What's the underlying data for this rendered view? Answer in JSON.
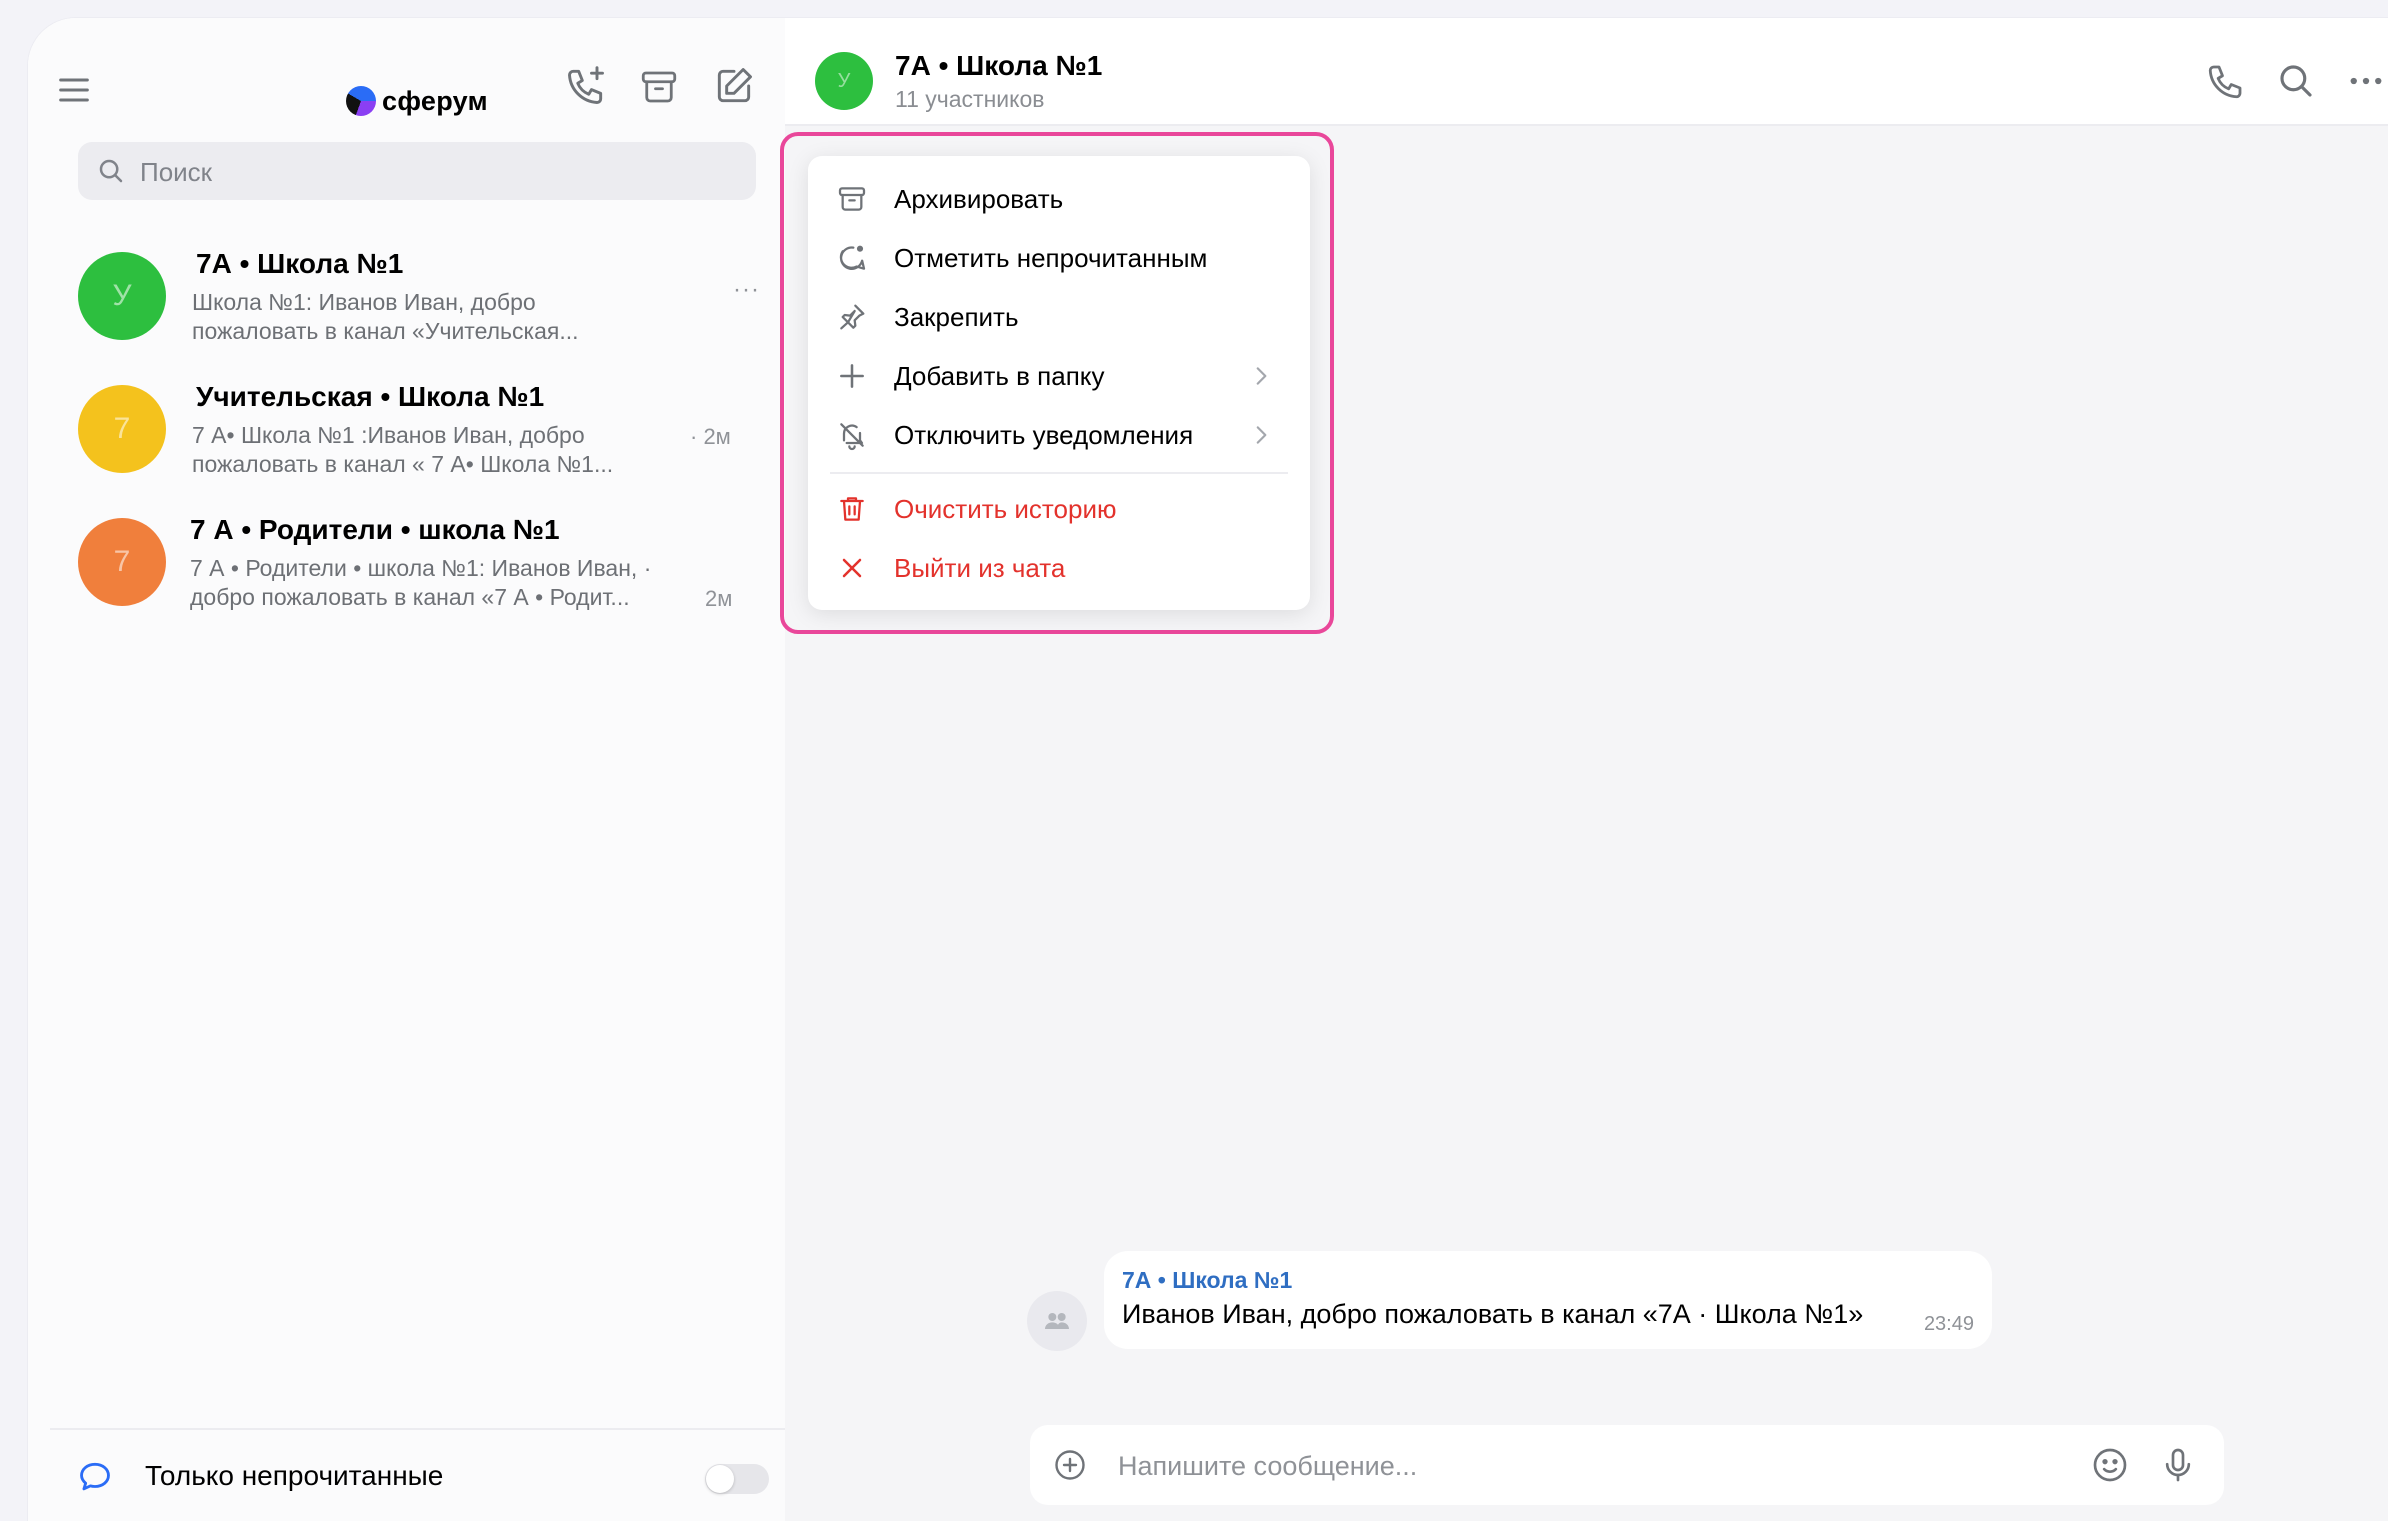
{
  "app": {
    "name": "сферум",
    "accent": "#2a6cf6",
    "danger_color": "#e3322c",
    "highlight_color": "#e9479a"
  },
  "sidebar": {
    "search": {
      "placeholder": "Поиск"
    },
    "header_icons": [
      "menu-icon",
      "call-add-icon",
      "archive-icon",
      "compose-icon"
    ],
    "chats": [
      {
        "title": "7А • Школа №1",
        "preview_line1": "Школа №1: Иванов Иван, добро",
        "preview_line2": "пожаловать в канал «Учительская...",
        "time": "",
        "more": "···",
        "avatar_letter": "У",
        "avatar_color": "#2dbf3f"
      },
      {
        "title": "Учительская • Школа №1",
        "preview_line1": "7 А• Школа №1 :Иванов Иван, добро",
        "preview_line2": "пожаловать в канал « 7 А• Школа №1...",
        "time": "· 2м",
        "avatar_letter": "7",
        "avatar_color": "#f4c21d"
      },
      {
        "title": "7 А • Родители • школа №1",
        "preview_line1": "7 А • Родители • школа №1: Иванов Иван, ·",
        "preview_line2": "добро пожаловать в канал «7 А • Родит...",
        "time": "2м",
        "avatar_letter": "7",
        "avatar_color": "#f07f3c"
      }
    ],
    "unread_only": {
      "label": "Только непрочитанные",
      "enabled": false
    }
  },
  "chat_header": {
    "title": "7А • Школа №1",
    "subtitle": "11 участников",
    "avatar_letter": "У",
    "icons": [
      "phone-icon",
      "search-icon",
      "more-icon"
    ]
  },
  "context_menu": {
    "items": [
      {
        "label": "Архивировать",
        "icon": "archive-icon"
      },
      {
        "label": "Отметить непрочитанным",
        "icon": "mark-unread-icon"
      },
      {
        "label": "Закрепить",
        "icon": "pin-icon"
      },
      {
        "label": "Добавить в папку",
        "icon": "plus-icon",
        "submenu": true
      },
      {
        "label": "Отключить уведомления",
        "icon": "bell-off-icon",
        "submenu": true
      },
      {
        "label": "Очистить историю",
        "icon": "trash-icon",
        "danger": true
      },
      {
        "label": "Выйти из чата",
        "icon": "close-icon",
        "danger": true
      }
    ]
  },
  "message": {
    "author": "7А • Школа №1",
    "text": "Иванов Иван, добро пожаловать в канал «7А · Школа №1»",
    "time": "23:49"
  },
  "composer": {
    "placeholder": "Напишите сообщение..."
  }
}
